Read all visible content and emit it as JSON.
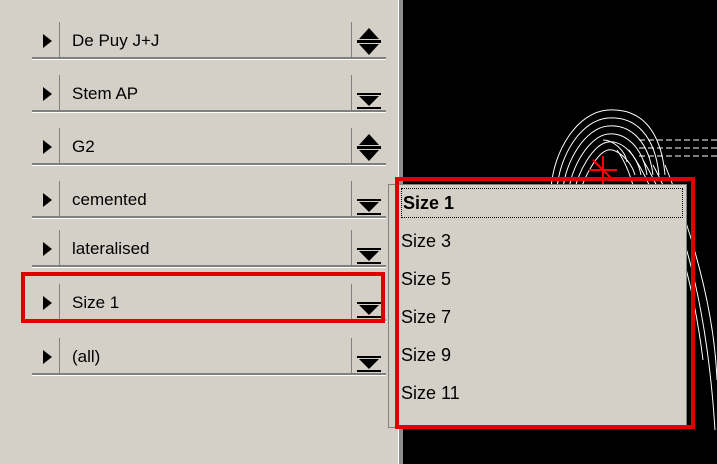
{
  "rows": [
    {
      "label": "De Puy  J+J",
      "control": "spinner"
    },
    {
      "label": "Stem AP",
      "control": "dropdown"
    },
    {
      "label": "G2",
      "control": "spinner"
    },
    {
      "label": "cemented",
      "control": "dropdown"
    },
    {
      "label": "lateralised",
      "control": "dropdown"
    },
    {
      "label": "Size  1",
      "control": "dropdown",
      "highlighted": true
    },
    {
      "label": "(all)",
      "control": "dropdown"
    }
  ],
  "dropdown": {
    "selected": "Size  1",
    "options": [
      "Size  1",
      "Size  3",
      "Size  5",
      "Size  7",
      "Size  9",
      "Size  11"
    ]
  },
  "colors": {
    "panel": "#d4d0c8",
    "viewer_bg": "#000000",
    "highlight": "#e00000",
    "marker": "#ff0000"
  }
}
